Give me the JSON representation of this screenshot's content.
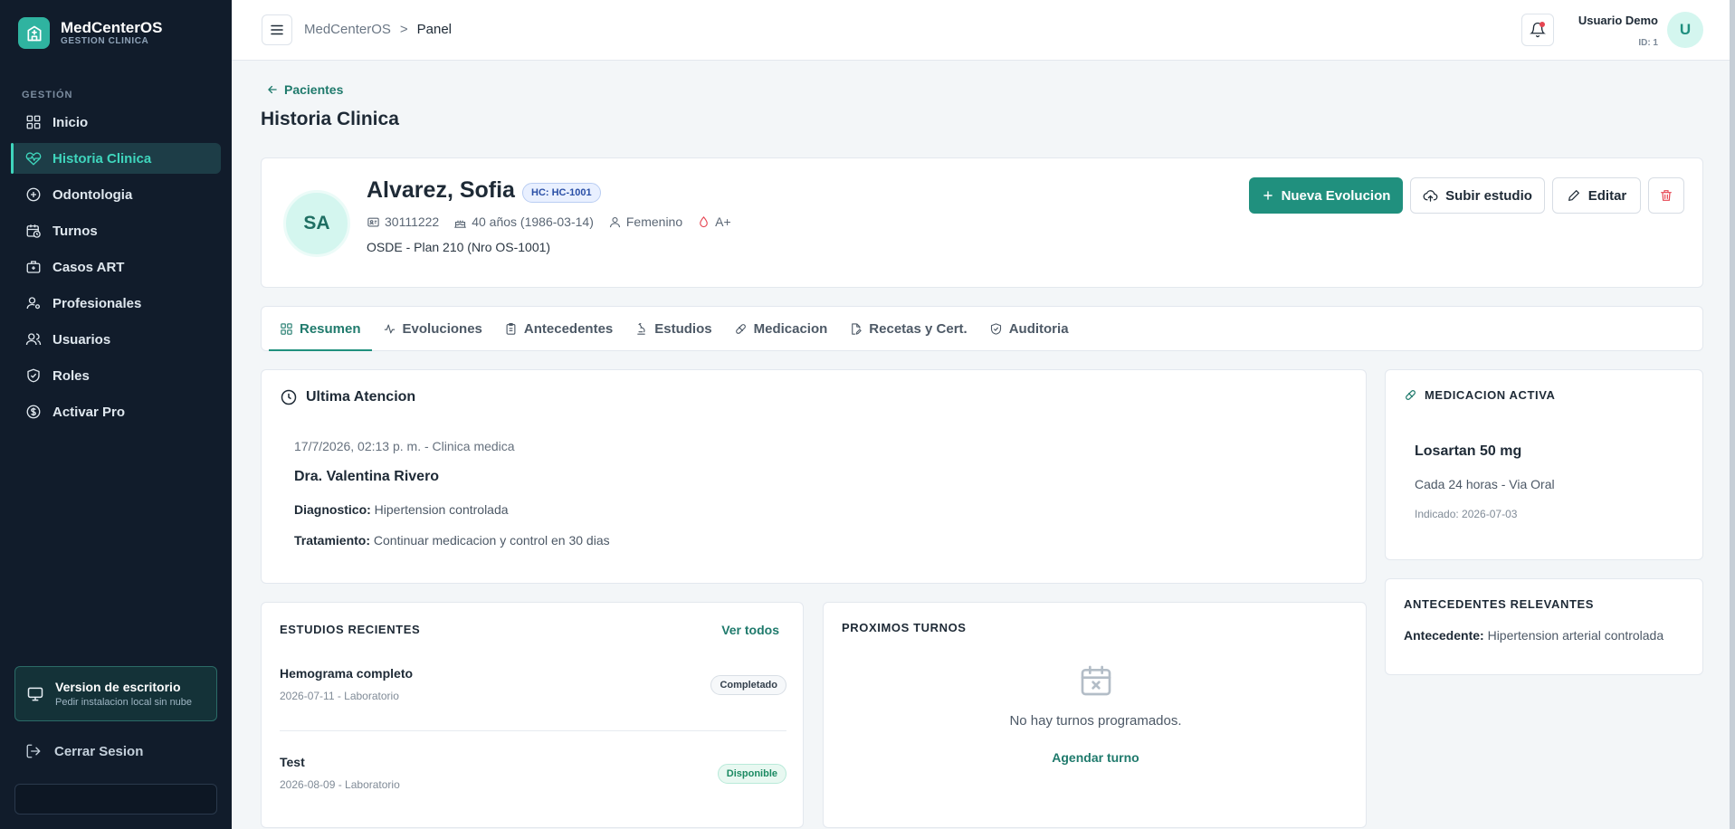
{
  "brand": {
    "name": "MedCenterOS",
    "subtitle": "GESTION CLINICA"
  },
  "sidebar": {
    "section_label": "GESTIÓN",
    "items": [
      {
        "label": "Inicio",
        "icon": "grid-icon",
        "active": false
      },
      {
        "label": "Historia Clinica",
        "icon": "heart-pulse-icon",
        "active": true
      },
      {
        "label": "Odontologia",
        "icon": "plus-circle-icon",
        "active": false
      },
      {
        "label": "Turnos",
        "icon": "calendar-clock-icon",
        "active": false
      },
      {
        "label": "Casos ART",
        "icon": "briefcase-medical-icon",
        "active": false
      },
      {
        "label": "Profesionales",
        "icon": "user-gear-icon",
        "active": false
      },
      {
        "label": "Usuarios",
        "icon": "users-icon",
        "active": false
      },
      {
        "label": "Roles",
        "icon": "shield-check-icon",
        "active": false
      },
      {
        "label": "Activar Pro",
        "icon": "dollar-circle-icon",
        "active": false
      }
    ],
    "desktop_card": {
      "title": "Version de escritorio",
      "subtitle": "Pedir instalacion local sin nube"
    },
    "logout": "Cerrar Sesion"
  },
  "topbar": {
    "breadcrumb": [
      "MedCenterOS",
      ">",
      "Panel"
    ],
    "user_name": "Usuario Demo",
    "user_id": "ID: 1",
    "user_initial": "U"
  },
  "page": {
    "back_label": "Pacientes",
    "title": "Historia Clinica"
  },
  "patient": {
    "initials": "SA",
    "name": "Alvarez, Sofia",
    "hc": "HC: HC-1001",
    "dni": "30111222",
    "age": "40 años (1986-03-14)",
    "sex": "Femenino",
    "blood": "A+",
    "plan": "OSDE - Plan 210 (Nro OS-1001)"
  },
  "actions": {
    "new_evolution": "Nueva Evolucion",
    "upload": "Subir estudio",
    "edit": "Editar"
  },
  "tabs": [
    {
      "label": "Resumen",
      "icon": "grid-icon",
      "active": true
    },
    {
      "label": "Evoluciones",
      "icon": "activity-icon",
      "active": false
    },
    {
      "label": "Antecedentes",
      "icon": "clipboard-icon",
      "active": false
    },
    {
      "label": "Estudios",
      "icon": "microscope-icon",
      "active": false
    },
    {
      "label": "Medicacion",
      "icon": "pill-icon",
      "active": false
    },
    {
      "label": "Recetas y Cert.",
      "icon": "file-pen-icon",
      "active": false
    },
    {
      "label": "Auditoria",
      "icon": "shield-check-icon",
      "active": false
    }
  ],
  "last_attention": {
    "title": "Ultima Atencion",
    "date": "17/7/2026, 02:13 p. m. - Clinica medica",
    "doctor": "Dra. Valentina Rivero",
    "diag_label": "Diagnostico:",
    "diag_value": "Hipertension controlada",
    "treat_label": "Tratamiento:",
    "treat_value": "Continuar medicacion y control en 30 dias"
  },
  "medication": {
    "title": "MEDICACION ACTIVA",
    "name": "Losartan 50 mg",
    "frequency": "Cada 24 horas - Via Oral",
    "indicated": "Indicado: 2026-07-03"
  },
  "antecedents": {
    "title": "ANTECEDENTES RELEVANTES",
    "label": "Antecedente:",
    "value": "Hipertension arterial controlada"
  },
  "studies": {
    "title": "ESTUDIOS RECIENTES",
    "see_all": "Ver todos",
    "items": [
      {
        "name": "Hemograma completo",
        "sub": "2026-07-11 - Laboratorio",
        "status": "Completado"
      },
      {
        "name": "Test",
        "sub": "2026-08-09 - Laboratorio",
        "status": "Disponible"
      }
    ]
  },
  "appointments": {
    "title": "PROXIMOS TURNOS",
    "empty": "No hay turnos programados.",
    "schedule": "Agendar turno"
  },
  "colors": {
    "accent": "#20907e",
    "sidebar_bg": "#111c2b",
    "active_text": "#3fd6bd",
    "danger": "#e64552"
  }
}
